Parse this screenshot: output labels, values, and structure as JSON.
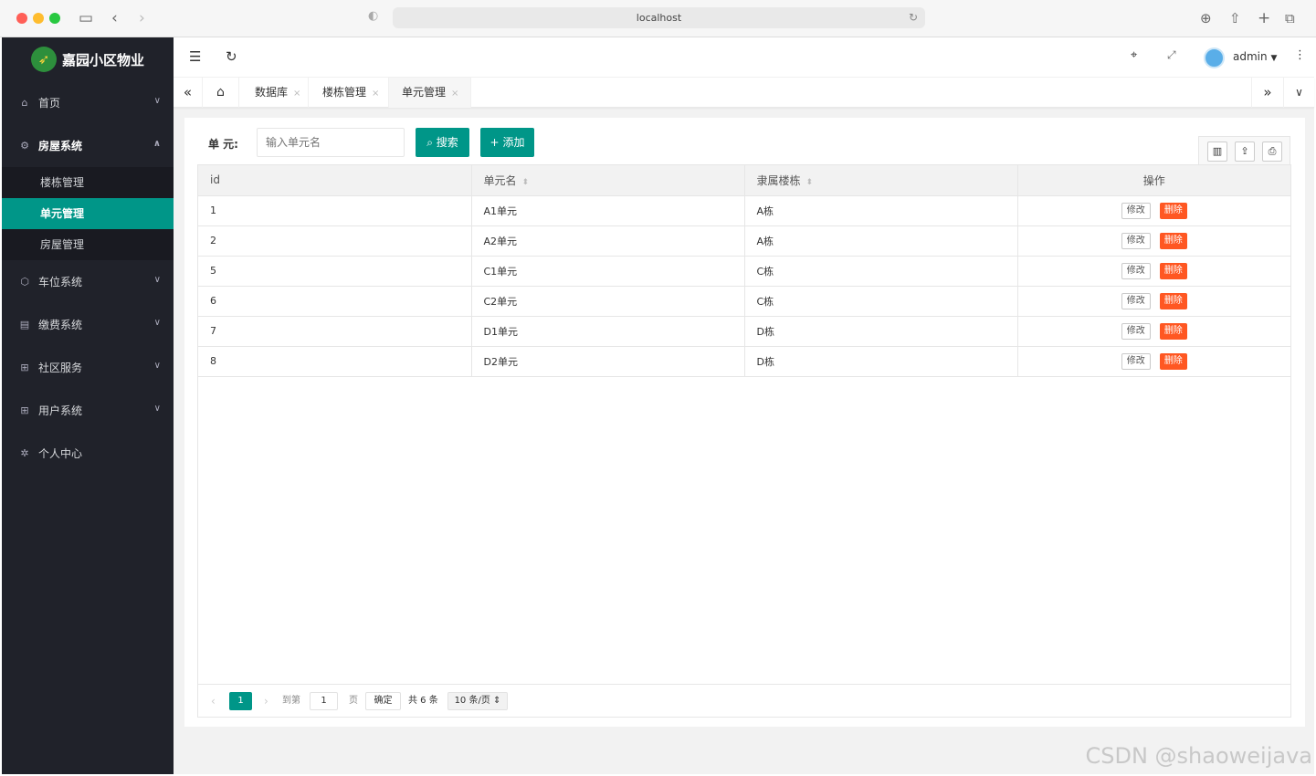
{
  "browser": {
    "url": "localhost"
  },
  "app": {
    "brand": "嘉园小区物业",
    "user": "admin"
  },
  "sidebar": {
    "items": [
      {
        "label": "首页"
      },
      {
        "label": "房屋系统"
      },
      {
        "label": "车位系统"
      },
      {
        "label": "缴费系统"
      },
      {
        "label": "社区服务"
      },
      {
        "label": "用户系统"
      },
      {
        "label": "个人中心"
      }
    ],
    "sub_items": [
      {
        "label": "楼栋管理"
      },
      {
        "label": "单元管理"
      },
      {
        "label": "房屋管理"
      }
    ]
  },
  "tabs": [
    {
      "label": "数据库"
    },
    {
      "label": "楼栋管理"
    },
    {
      "label": "单元管理"
    }
  ],
  "toolbar": {
    "unit_label": "单 元:",
    "unit_placeholder": "输入单元名",
    "search_label": "搜索",
    "add_label": "添加"
  },
  "table": {
    "columns": [
      "id",
      "单元名",
      "隶属楼栋",
      "操作"
    ],
    "edit_label": "修改",
    "delete_label": "删除",
    "rows": [
      {
        "id": "1",
        "name": "A1单元",
        "building": "A栋"
      },
      {
        "id": "2",
        "name": "A2单元",
        "building": "A栋"
      },
      {
        "id": "5",
        "name": "C1单元",
        "building": "C栋"
      },
      {
        "id": "6",
        "name": "C2单元",
        "building": "C栋"
      },
      {
        "id": "7",
        "name": "D1单元",
        "building": "D栋"
      },
      {
        "id": "8",
        "name": "D2单元",
        "building": "D栋"
      }
    ]
  },
  "pager": {
    "current": "1",
    "goto_label": "到第",
    "goto_value": "1",
    "page_label": "页",
    "confirm": "确定",
    "total": "共 6 条",
    "page_size": "10 条/页"
  },
  "watermark": "CSDN @shaoweijava",
  "colors": {
    "accent": "#009688",
    "danger": "#ff5722",
    "sidebar": "#20222a"
  }
}
